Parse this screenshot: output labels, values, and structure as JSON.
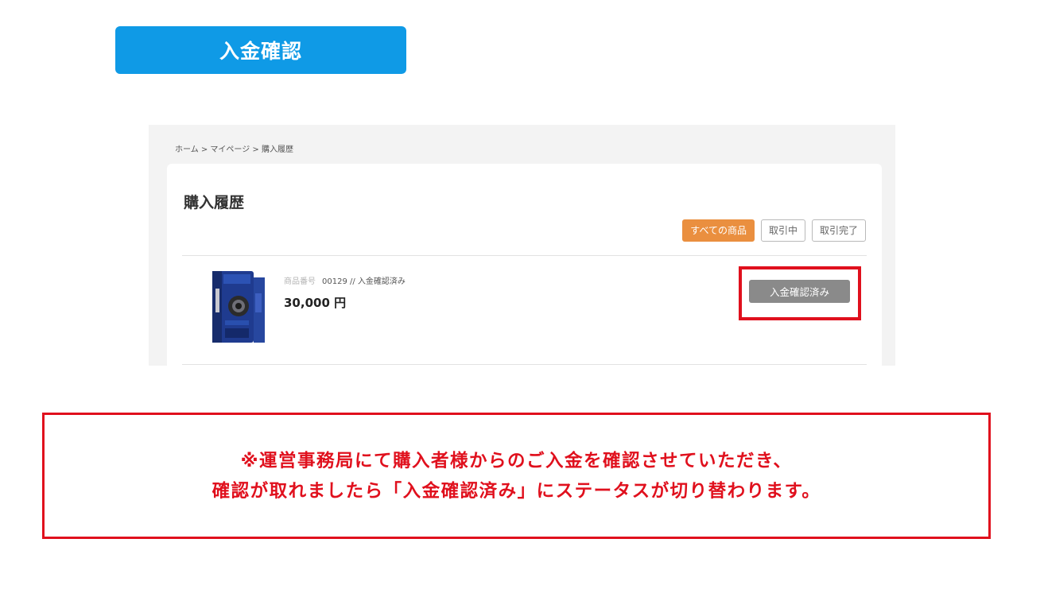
{
  "header": {
    "title": "入金確認"
  },
  "screenshot": {
    "breadcrumb": "ホーム > マイページ > 購入履歴",
    "page_title": "購入履歴",
    "filters": [
      {
        "label": "すべての商品",
        "active": true
      },
      {
        "label": "取引中",
        "active": false
      },
      {
        "label": "取引完了",
        "active": false
      }
    ],
    "item": {
      "number_label": "商品番号",
      "number_value": "00129 // 入金確認済み",
      "price": "30,000 円",
      "status_button": "入金確認済み"
    }
  },
  "note": {
    "line1": "※運営事務局にて購入者様からのご入金を確認させていただき、",
    "line2": "確認が取れましたら「入金確認済み」にステータスが切り替わります。"
  },
  "colors": {
    "header_blue": "#0f9ae6",
    "accent_orange": "#ea8f3f",
    "highlight_red": "#e0101d",
    "status_gray": "#8a8a8a"
  }
}
